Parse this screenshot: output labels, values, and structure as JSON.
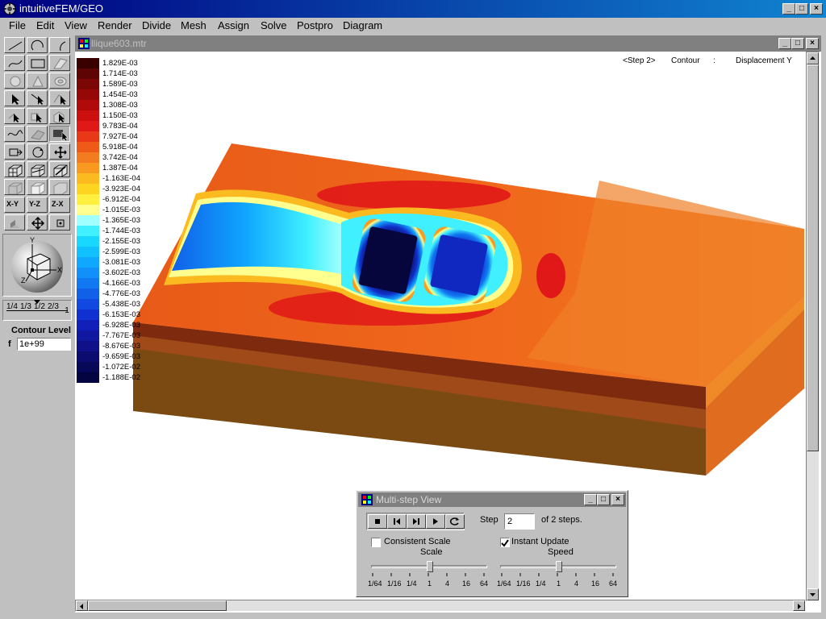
{
  "window": {
    "title": "intuitiveFEM/GEO"
  },
  "menu": [
    "File",
    "Edit",
    "View",
    "Render",
    "Divide",
    "Mesh",
    "Assign",
    "Solve",
    "Postpro",
    "Diagram"
  ],
  "toolbar": {
    "level_numbers": [
      "1/4",
      "1/3",
      "1/2",
      "2/3",
      "1"
    ],
    "contour_level_label": "Contour Level",
    "f_label": "f",
    "level_value": "1e+99",
    "axis_labels": [
      "Y",
      "X",
      "Z"
    ],
    "axis_buttons": [
      "X-Y",
      "Y-Z",
      "Z-X"
    ]
  },
  "child": {
    "title": "llique603.mtr",
    "header": {
      "step": "<Step 2>",
      "mode": "Contour",
      "sep": ":",
      "quantity": "Displacement Y"
    }
  },
  "legend": [
    {
      "label": "1.829E-03",
      "color": "#3a0000"
    },
    {
      "label": "1.714E-03",
      "color": "#5e0404"
    },
    {
      "label": "1.589E-03",
      "color": "#7a0606"
    },
    {
      "label": "1.454E-03",
      "color": "#960808"
    },
    {
      "label": "1.308E-03",
      "color": "#b00a0a"
    },
    {
      "label": "1.150E-03",
      "color": "#cc1010"
    },
    {
      "label": "9.783E-04",
      "color": "#e01818"
    },
    {
      "label": "7.927E-04",
      "color": "#e83818"
    },
    {
      "label": "5.918E-04",
      "color": "#f05a18"
    },
    {
      "label": "3.742E-04",
      "color": "#f47c20"
    },
    {
      "label": "1.387E-04",
      "color": "#f89a20"
    },
    {
      "label": "-1.163E-04",
      "color": "#fbba20"
    },
    {
      "label": "-3.923E-04",
      "color": "#fdd420"
    },
    {
      "label": "-6.912E-04",
      "color": "#fff040"
    },
    {
      "label": "-1.015E-03",
      "color": "#ffff90"
    },
    {
      "label": "-1.365E-03",
      "color": "#a0ffff"
    },
    {
      "label": "-1.744E-03",
      "color": "#40f0ff"
    },
    {
      "label": "-2.155E-03",
      "color": "#18d8ff"
    },
    {
      "label": "-2.599E-03",
      "color": "#10c0ff"
    },
    {
      "label": "-3.081E-03",
      "color": "#10a8ff"
    },
    {
      "label": "-3.602E-03",
      "color": "#1090f8"
    },
    {
      "label": "-4.166E-03",
      "color": "#1078f0"
    },
    {
      "label": "-4.776E-03",
      "color": "#1060e8"
    },
    {
      "label": "-5.438E-03",
      "color": "#1048e0"
    },
    {
      "label": "-6.153E-03",
      "color": "#1030d0"
    },
    {
      "label": "-6.928E-03",
      "color": "#1020b8"
    },
    {
      "label": "-7.767E-03",
      "color": "#1018a0"
    },
    {
      "label": "-8.676E-03",
      "color": "#101088"
    },
    {
      "label": "-9.659E-03",
      "color": "#0c0c70"
    },
    {
      "label": "-1.072E-02",
      "color": "#080858"
    },
    {
      "label": "-1.188E-02",
      "color": "#040440"
    }
  ],
  "dialog": {
    "title": "Multi-step View",
    "step_label": "Step",
    "step_value": "2",
    "of_steps": "of 2 steps.",
    "consistent_scale": {
      "label": "Consistent Scale",
      "checked": false
    },
    "instant_update": {
      "label": "Instant Update",
      "checked": true
    },
    "scale_label": "Scale",
    "speed_label": "Speed",
    "ticks": [
      "1/64",
      "1/16",
      "1/4",
      "1",
      "4",
      "16",
      "64"
    ],
    "scale_value": "1",
    "speed_value": "1"
  }
}
